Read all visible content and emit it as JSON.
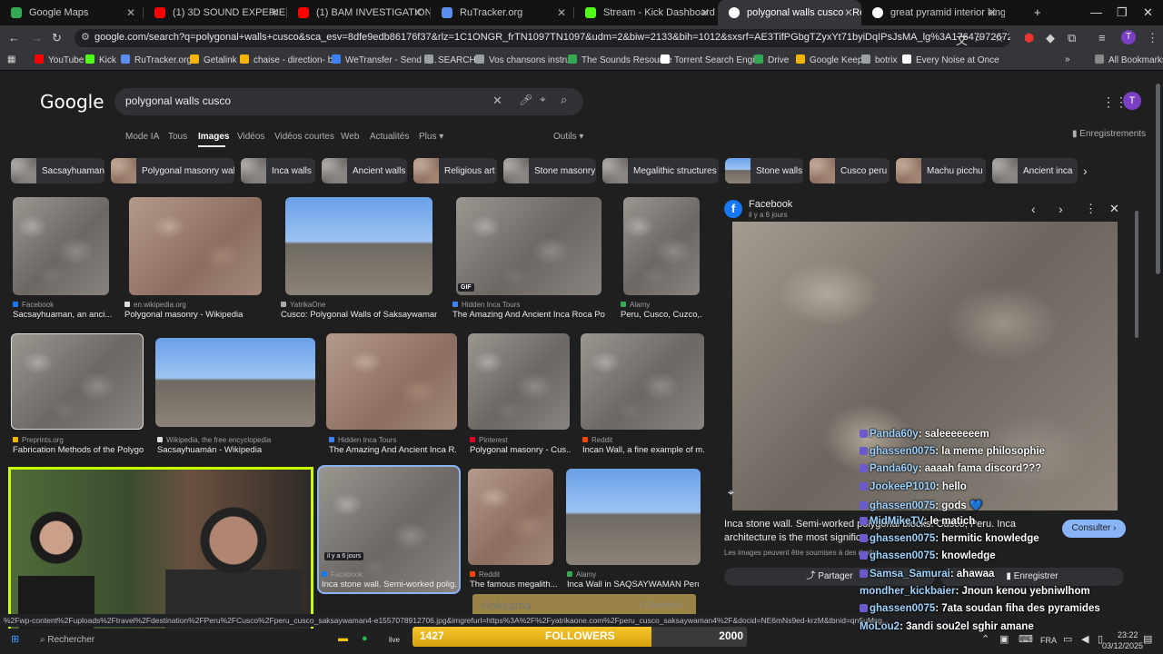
{
  "tabs": [
    {
      "label": "Google Maps",
      "color": "#34a853"
    },
    {
      "label": "(1) 3D SOUND EXPERIENCE IN",
      "color": "#ff0000"
    },
    {
      "label": "(1) BAM INVESTIGATIONS - JAV",
      "color": "#ff0000"
    },
    {
      "label": "RuTracker.org",
      "color": "#5b8def"
    },
    {
      "label": "Stream - Kick Dashboard",
      "color": "#53fc18"
    },
    {
      "label": "polygonal walls cusco - Recher",
      "color": "#ffffff"
    },
    {
      "label": "great pyramid interior king cha",
      "color": "#ffffff"
    }
  ],
  "toolbar": {
    "url": "google.com/search?q=polygonal+walls+cusco&sca_esv=8dfe9edb86176f37&rlz=1C1ONGR_frTN1097TN1097&udm=2&biw=2133&bih=1012&sxsrf=AE3TifPGbgTZyxYt71byiDqIPsJsMA_lg%3A1764797267265&ei=U6swaZr1",
    "profile_initial": "T"
  },
  "bookmarks": [
    {
      "label": "YouTube",
      "color": "#ff0000"
    },
    {
      "label": "Kick",
      "color": "#53fc18"
    },
    {
      "label": "RuTracker.org",
      "color": "#5b8def"
    },
    {
      "label": "Getalink",
      "color": "#f4b400"
    },
    {
      "label": "chaise - direction- b...",
      "color": "#f4b400"
    },
    {
      "label": "WeTransfer - Send L...",
      "color": "#3b82f6"
    },
    {
      "label": "SEARCH",
      "color": "#9aa0a6"
    },
    {
      "label": "Vos chansons instru...",
      "color": "#9aa0a6"
    },
    {
      "label": "The Sounds Resource",
      "color": "#34a853"
    },
    {
      "label": "Torrent Search Engi...",
      "color": "#ffffff"
    },
    {
      "label": "Drive",
      "color": "#34a853"
    },
    {
      "label": "Google Keep",
      "color": "#f4b400"
    },
    {
      "label": "botrix",
      "color": "#9aa0a6"
    },
    {
      "label": "Every Noise at Once",
      "color": "#ffffff"
    }
  ],
  "all_bookmarks": "All Bookmarks",
  "google": {
    "logo": "Google",
    "query": "polygonal walls cusco",
    "nav": [
      "Mode IA",
      "Tous",
      "Images",
      "Vidéos",
      "Vidéos courtes",
      "Web",
      "Actualités",
      "Plus"
    ],
    "tools": "Outils",
    "saved": "Enregistrements",
    "avatar": "T",
    "chips": [
      "Sacsayhuaman",
      "Polygonal masonry wall",
      "Inca walls",
      "Ancient walls",
      "Religious art",
      "Stone masonry",
      "Megalithic structures",
      "Stone walls",
      "Cusco peru",
      "Machu picchu",
      "Ancient inca"
    ]
  },
  "results": [
    {
      "source": "Facebook",
      "title": "Sacsayhuaman, an anci...",
      "color": "#1877f2"
    },
    {
      "source": "en.wikipedia.org",
      "title": "Polygonal masonry - Wikipedia",
      "color": "#dddddd"
    },
    {
      "source": "YatrikaOne",
      "title": "Cusco: Polygonal Walls of Saksaywaman",
      "color": "#aaaaaa"
    },
    {
      "source": "Hidden Inca Tours",
      "title": "The Amazing And Ancient Inca Roca Poly...",
      "color": "#3b82f6",
      "badge": "GIF"
    },
    {
      "source": "Alamy",
      "title": "Peru, Cusco, Cuzco,...",
      "color": "#34a853"
    },
    {
      "source": "Preprints.org",
      "title": "Fabrication Methods of the Polygo...",
      "color": "#f4b400"
    },
    {
      "source": "Wikipedia, the free encyclopedia",
      "title": "Sacsayhuamán - Wikipedia",
      "color": "#dddddd"
    },
    {
      "source": "Hidden Inca Tours",
      "title": "The Amazing And Ancient Inca R...",
      "color": "#3b82f6"
    },
    {
      "source": "Pinterest",
      "title": "Polygonal masonry - Cus...",
      "color": "#e60023"
    },
    {
      "source": "Reddit",
      "title": "Incan Wall, a fine example of m...",
      "color": "#ff4500"
    },
    {
      "source": "Facebook",
      "title": "Inca stone wall. Semi-worked polig...",
      "color": "#1877f2",
      "badge": "il y a 6 jours"
    },
    {
      "source": "Reddit",
      "title": "The famous megalith...",
      "color": "#ff4500"
    },
    {
      "source": "Alamy",
      "title": "Inca Wall in SAQSAYWAMAN Peru ...",
      "color": "#34a853"
    }
  ],
  "panel": {
    "source": "Facebook",
    "age": "il y a 6 jours",
    "caption1": "Inca stone wall. Semi-worked polygonal blocks. Cusco, Peru. Inca",
    "caption2": "architecture is the most signific",
    "caption2_tail": "...",
    "rights": "Les images peuvent être soumises à des droits",
    "visit": "Consulter",
    "share": "Partager",
    "save": "Enregistrer"
  },
  "chat": [
    {
      "user": "Panda60y",
      "msg": ": saleeeeeeem"
    },
    {
      "user": "ghassen0075",
      "msg": ": la meme philosophie"
    },
    {
      "user": "Panda60y",
      "msg": ": aaaah fama discord???"
    },
    {
      "user": "JookeeP1010",
      "msg": ": hello"
    },
    {
      "user": "ghassen0075",
      "msg": ": gods 💙"
    },
    {
      "user": "MidMikeTV",
      "msg": ": le matich"
    },
    {
      "user": "ghassen0075",
      "msg": ": hermitic knowledge"
    },
    {
      "user": "ghassen0075",
      "msg": ": knowledge"
    },
    {
      "user": "Samsa_Samurai",
      "msg": ": ahawaa"
    },
    {
      "user": "mondher_kickbaier",
      "msg": ": Jnoun kenou yebniwlhom"
    },
    {
      "user": "ghassen0075",
      "msg": ": 7ata soudan fiha des pyramides"
    },
    {
      "user": "MoLou2",
      "msg": ": 3andi sou2el sghir amane"
    }
  ],
  "overlay": {
    "hoksama": "Hoksama",
    "diamond": "1 Diamond"
  },
  "followers": {
    "current": "1427",
    "label": "FOLLOWERS",
    "goal": "2000",
    "progress": 0.7135
  },
  "statusbar": {
    "url": "%2Fwp-content%2Fuploads%2Ftravel%2Fdestination%2FPeru%2FCusco%2Fperu_cusco_saksaywaman4-e1557078912706.jpg&imgrefurl=https%3A%2F%2Fyatrikaone.com%2Fperu_cusco_saksaywaman4%2F&docid=NE6mNs9ed-krzM&tbnid=qn5uMsg..."
  },
  "taskbar": {
    "search": "Rechercher",
    "lang": "FRA",
    "time": "23:22",
    "date": "03/12/2025"
  }
}
